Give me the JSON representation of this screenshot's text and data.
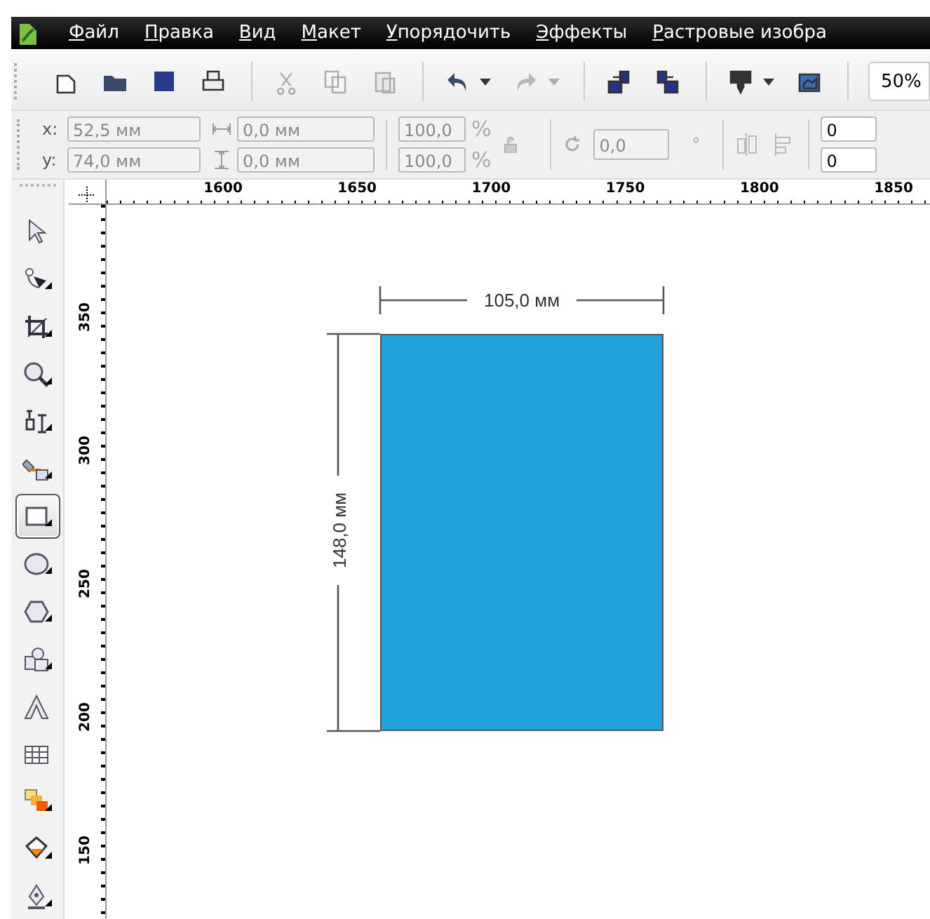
{
  "menu": {
    "items": [
      "Файл",
      "Правка",
      "Вид",
      "Макет",
      "Упорядочить",
      "Эффекты",
      "Растровые изобра"
    ]
  },
  "toolbar": {
    "buttons": [
      {
        "disabled": false
      },
      {
        "disabled": false
      },
      {
        "disabled": false
      },
      {
        "disabled": false
      },
      {
        "disabled": true
      },
      {
        "disabled": true
      },
      {
        "disabled": true
      },
      {
        "disabled": false
      },
      {
        "disabled": true
      },
      {
        "disabled": false
      },
      {
        "disabled": false
      },
      {
        "disabled": false
      },
      {
        "disabled": false
      }
    ],
    "zoom": "50%"
  },
  "property_bar": {
    "position": [
      {
        "label": "x:",
        "value": "52,5 мм",
        "disabled": true
      },
      {
        "label": "y:",
        "value": "74,0 мм",
        "disabled": true
      }
    ],
    "size": [
      {
        "value": "0,0 мм",
        "disabled": true
      },
      {
        "value": "0,0 мм",
        "disabled": true
      }
    ],
    "scale": [
      {
        "value": "100,0",
        "unit": "%",
        "disabled": true
      },
      {
        "value": "100,0",
        "unit": "%",
        "disabled": true
      }
    ],
    "rotation": {
      "value": "0,0",
      "unit": "°",
      "disabled": true
    },
    "column_5": [
      {
        "value": "0",
        "disabled": false
      },
      {
        "value": "0",
        "disabled": false
      }
    ]
  },
  "rulers": {
    "horizontal": [
      "1600",
      "1650",
      "1700",
      "1750",
      "1800",
      "1850"
    ],
    "vertical": [
      "350",
      "300",
      "250",
      "200",
      "150"
    ]
  },
  "toolbox": {
    "tools": [
      {
        "selected": false,
        "flyout": false
      },
      {
        "selected": false,
        "flyout": true
      },
      {
        "selected": false,
        "flyout": true
      },
      {
        "selected": false,
        "flyout": true
      },
      {
        "selected": false,
        "flyout": true
      },
      {
        "selected": false,
        "flyout": true
      },
      {
        "selected": true,
        "flyout": true
      },
      {
        "selected": false,
        "flyout": true
      },
      {
        "selected": false,
        "flyout": true
      },
      {
        "selected": false,
        "flyout": true
      },
      {
        "selected": false,
        "flyout": false
      },
      {
        "selected": false,
        "flyout": false
      },
      {
        "selected": false,
        "flyout": true
      },
      {
        "selected": false,
        "flyout": true
      },
      {
        "selected": false,
        "flyout": true
      }
    ]
  },
  "canvas": {
    "width_dimension": "105,0 мм",
    "height_dimension": "148,0 мм"
  }
}
